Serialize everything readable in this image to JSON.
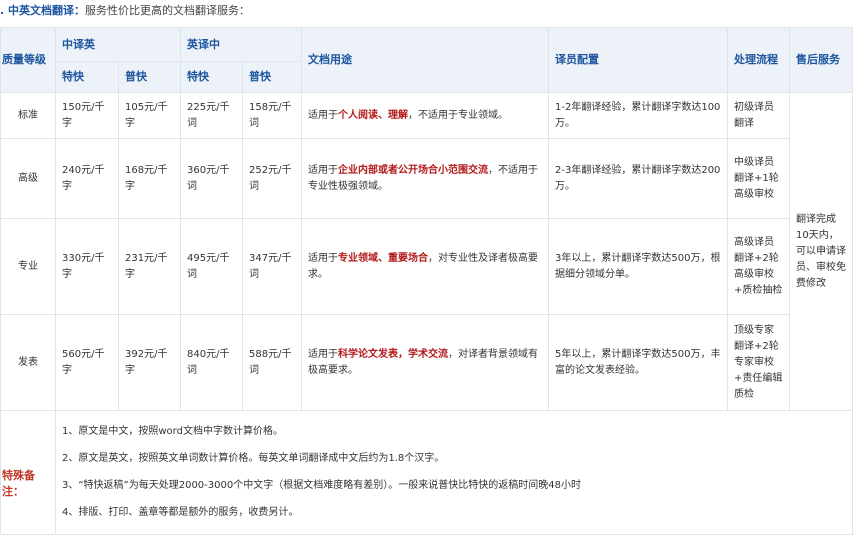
{
  "heading": {
    "title": ". 中英文档翻译：",
    "subtitle": "服务性价比更高的文档翻译服务："
  },
  "table": {
    "headers": {
      "quality": "质量等级",
      "zh_en": "中译英",
      "en_zh": "英译中",
      "express": "特快",
      "normal": "普快",
      "usage": "文档用途",
      "translator": "译员配置",
      "process": "处理流程",
      "after_sales": "售后服务"
    },
    "rows": [
      {
        "level": "标准",
        "zh_express": "150元/千字",
        "zh_normal": "105元/千字",
        "en_express": "225元/千词",
        "en_normal": "158元/千词",
        "usage_pre": "适用于",
        "usage_hl1": "个人阅读",
        "usage_mid": "、",
        "usage_hl2": "理解",
        "usage_post": "，不适用于专业领域。",
        "translator": "1-2年翻译经验，累计翻译字数达100万。",
        "process": "初级译员翻译"
      },
      {
        "level": "高级",
        "zh_express": "240元/千字",
        "zh_normal": "168元/千字",
        "en_express": "360元/千词",
        "en_normal": "252元/千词",
        "usage_pre": "适用于",
        "usage_hl1": "企业内部或者公开场合小范围交流",
        "usage_mid": "",
        "usage_hl2": "",
        "usage_post": "，不适用于专业性极强领域。",
        "translator": "2-3年翻译经验，累计翻译字数达200万。",
        "process": "中级译员翻译+1轮高级审校"
      },
      {
        "level": "专业",
        "zh_express": "330元/千字",
        "zh_normal": "231元/千字",
        "en_express": "495元/千词",
        "en_normal": "347元/千词",
        "usage_pre": "适用于",
        "usage_hl1": "专业领域",
        "usage_mid": "、",
        "usage_hl2": "重要场合",
        "usage_post": "，对专业性及译者极高要求。",
        "translator": "3年以上，累计翻译字数达500万，根据细分领域分单。",
        "process": "高级译员翻译+2轮高级审校+质检抽检"
      },
      {
        "level": "发表",
        "zh_express": "560元/千字",
        "zh_normal": "392元/千字",
        "en_express": "840元/千词",
        "en_normal": "588元/千词",
        "usage_pre": "适用于",
        "usage_hl1": "科学论文发表",
        "usage_mid": "，",
        "usage_hl2": "学术交流",
        "usage_post": "，对译者背景领域有极高要求。",
        "translator": "5年以上，累计翻译字数达500万，丰富的论文发表经验。",
        "process": "顶级专家翻译+2轮专家审校+责任编辑质检"
      }
    ],
    "after_sales_text": "翻译完成10天内，可以申请译员、审校免费修改"
  },
  "special_notes": {
    "label": "特殊备注：",
    "items": [
      "1、原文是中文，按照word文档中字数计算价格。",
      "2、原文是英文，按照英文单词数计算价格。每英文单词翻译成中文后约为1.8个汉字。",
      "3、“特快返稿”为每天处理2000-3000个中文字（根据文档难度略有差别）。一般来说普快比特快的返稿时间晚48小时",
      "4、排版、打印、盖章等都是额外的服务，收费另计。"
    ]
  }
}
